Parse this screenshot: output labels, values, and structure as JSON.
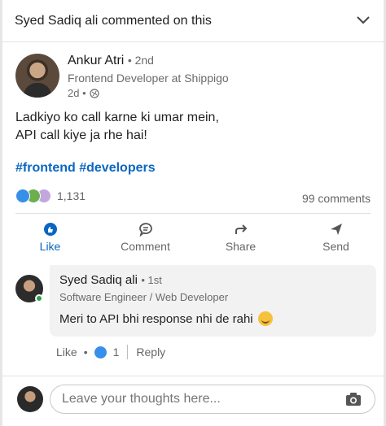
{
  "header": {
    "title": "Syed Sadiq ali commented on this"
  },
  "post": {
    "author_name": "Ankur Atri",
    "author_degree": "• 2nd",
    "author_headline": "Frontend Developer at Shippigo",
    "time": "2d •",
    "text_line1": "Ladkiyo ko call karne ki umar mein,",
    "text_line2": "API call kiye ja rhe hai!",
    "hashtag1": "#frontend",
    "hashtag2": "#developers",
    "reaction_count": "1,131",
    "comments_count": "99 comments"
  },
  "actions": {
    "like": "Like",
    "comment": "Comment",
    "share": "Share",
    "send": "Send"
  },
  "comment": {
    "name": "Syed Sadiq ali",
    "degree": "• 1st",
    "headline": "Software Engineer / Web Developer",
    "text": "Meri to API bhi response nhi de rahi",
    "like_label": "Like",
    "dot": "•",
    "like_count": "1",
    "reply_label": "Reply"
  },
  "compose": {
    "placeholder": "Leave your thoughts here..."
  },
  "colors": {
    "accent": "#0a66c2",
    "like": "#378fe9",
    "online": "#2e9e49"
  }
}
